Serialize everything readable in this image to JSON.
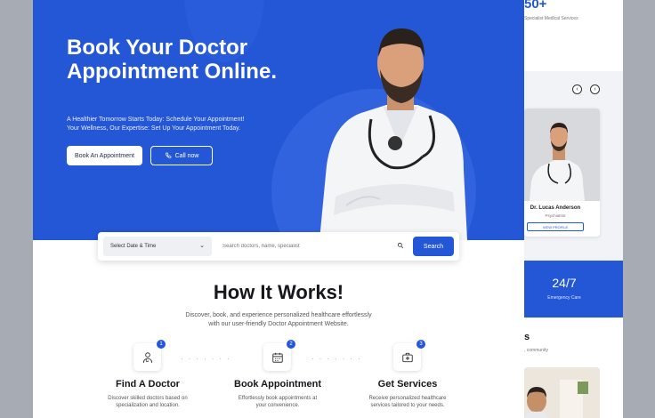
{
  "hero": {
    "title": "Book Your Doctor Appointment Online.",
    "subtitle_line1": "A Healthier Tomorrow Starts Today: Schedule Your Appointment!",
    "subtitle_line2": "Your Wellness, Our Expertise: Set Up Your Appointment Today.",
    "book_button": "Book An Appointment",
    "call_button": "Call now"
  },
  "search": {
    "date_select": "Select Date & Time",
    "placeholder": "Search doctors, name, specialist",
    "button": "Search"
  },
  "how_it_works": {
    "title": "How It Works!",
    "subtitle_line1": "Discover, book, and experience personalized healthcare effortlessly",
    "subtitle_line2": "with our user-friendly Doctor Appointment Website.",
    "steps": [
      {
        "num": "1",
        "icon": "doctor-icon",
        "title": "Find A Doctor",
        "desc_line1": "Discover skilled doctors based on",
        "desc_line2": "specialization and location."
      },
      {
        "num": "2",
        "icon": "calendar-icon",
        "title": "Book Appointment",
        "desc_line1": "Effortlessly book appointments at",
        "desc_line2": "your convenience."
      },
      {
        "num": "3",
        "icon": "medical-kit-icon",
        "title": "Get Services",
        "desc_line1": "Receive personalized healthcare",
        "desc_line2": "services tailored to your needs."
      }
    ]
  },
  "side": {
    "stat_value": "50+",
    "stat_label": "Specialist Medical Services",
    "doctor_card": {
      "name": "Dr. Lucas Anderson",
      "role": "Psychiatrist",
      "button": "VIEW PROFILE"
    },
    "emergency_value": "24/7",
    "emergency_label": "Emergency Care",
    "section_letter": "s",
    "section_sub": ", community"
  },
  "colors": {
    "primary": "#2457d6",
    "dark_text": "#16161c"
  }
}
